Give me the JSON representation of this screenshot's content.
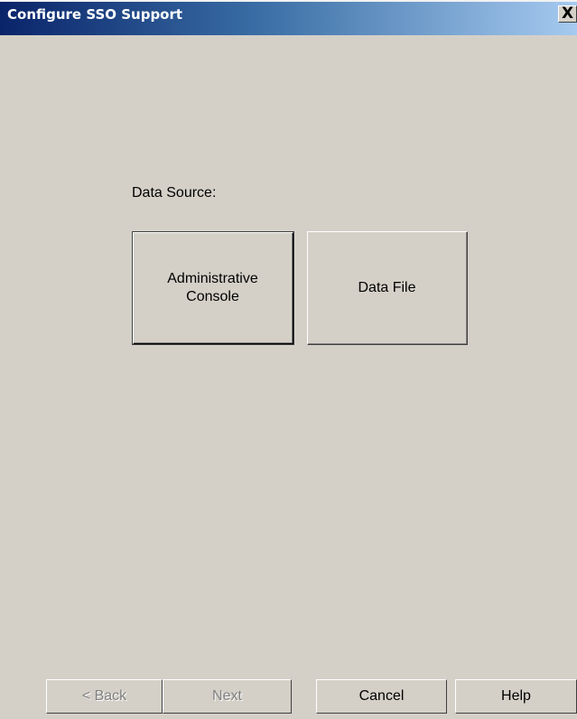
{
  "window": {
    "title": "Configure SSO Support",
    "close_symbol": "X"
  },
  "main": {
    "data_source_label": "Data Source:",
    "options": [
      {
        "line1": "Administrative",
        "line2": "Console",
        "selected": true
      },
      {
        "line1": "Data File",
        "line2": "",
        "selected": false
      }
    ]
  },
  "footer": {
    "back_label": "< Back",
    "next_label": "Next",
    "cancel_label": "Cancel",
    "help_label": "Help",
    "back_enabled": false,
    "next_enabled": false
  },
  "colors": {
    "dialog_background": "#d4d0c8",
    "titlebar_start": "#0a246a",
    "titlebar_end": "#a6caf0",
    "disabled_text": "#808080"
  },
  "icons": {
    "close": "close-icon"
  }
}
